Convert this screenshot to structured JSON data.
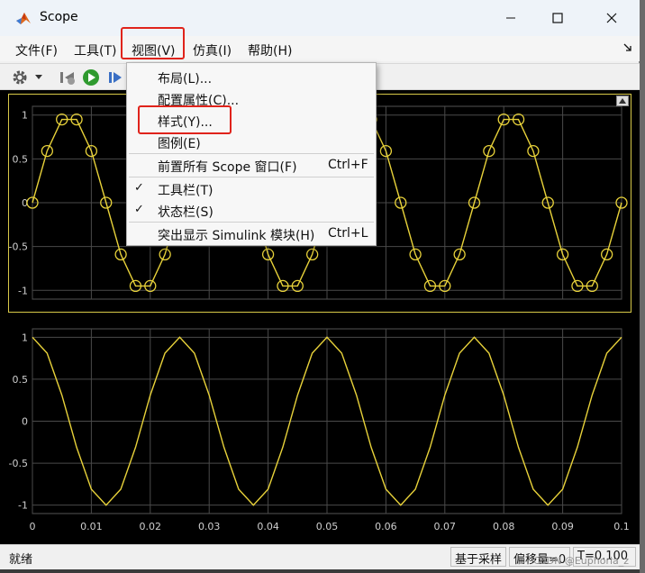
{
  "window": {
    "title": "Scope"
  },
  "menubar": {
    "items": [
      {
        "label": "文件(F)"
      },
      {
        "label": "工具(T)"
      },
      {
        "label": "视图(V)"
      },
      {
        "label": "仿真(I)"
      },
      {
        "label": "帮助(H)"
      }
    ]
  },
  "toolbar": {
    "icons": [
      "gear-icon",
      "dropdown-arrow-icon",
      "step-back-icon",
      "run-icon",
      "step-forward-icon"
    ]
  },
  "view_menu": {
    "items": [
      {
        "label": "布局(L)...",
        "accel": ""
      },
      {
        "label": "配置属性(C)...",
        "accel": ""
      },
      {
        "label": "样式(Y)...",
        "accel": ""
      },
      {
        "label": "图例(E)",
        "accel": ""
      },
      {
        "label": "前置所有 Scope 窗口(F)",
        "accel": "Ctrl+F"
      },
      {
        "label": "工具栏(T)",
        "accel": "",
        "checked": true
      },
      {
        "label": "状态栏(S)",
        "accel": "",
        "checked": true
      },
      {
        "label": "突出显示 Simulink 模块(H)",
        "accel": "Ctrl+L"
      }
    ]
  },
  "chart_data": [
    {
      "type": "line",
      "markers": "circle",
      "series": [
        {
          "color": "#e8d23a",
          "x": [
            0,
            0.0025,
            0.005,
            0.0075,
            0.01,
            0.0125,
            0.015,
            0.0175,
            0.02,
            0.0225,
            0.025,
            0.0275,
            0.03,
            0.0325,
            0.035,
            0.0375,
            0.04,
            0.0425,
            0.045,
            0.0475,
            0.05,
            0.0525,
            0.055,
            0.0575,
            0.06,
            0.0625,
            0.065,
            0.0675,
            0.07,
            0.0725,
            0.075,
            0.0775,
            0.08,
            0.0825,
            0.085,
            0.0875,
            0.09,
            0.0925,
            0.095,
            0.0975,
            0.1
          ],
          "y": [
            0,
            0.59,
            0.95,
            0.95,
            0.59,
            0,
            -0.59,
            -0.95,
            -0.95,
            -0.59,
            0,
            0.59,
            0.95,
            0.95,
            0.59,
            0,
            -0.59,
            -0.95,
            -0.95,
            -0.59,
            0,
            0.59,
            0.95,
            0.95,
            0.59,
            0,
            -0.59,
            -0.95,
            -0.95,
            -0.59,
            0,
            0.59,
            0.95,
            0.95,
            0.59,
            0,
            -0.59,
            -0.95,
            -0.95,
            -0.59,
            0
          ]
        }
      ],
      "ylim": [
        -1.1,
        1.1
      ],
      "xlim": [
        0,
        0.1
      ],
      "yticks": [
        "1",
        "0.5",
        "0",
        "-0.5",
        "-1"
      ],
      "grid": true
    },
    {
      "type": "line",
      "series": [
        {
          "color": "#e8d23a",
          "x": [
            0,
            0.0025,
            0.005,
            0.0075,
            0.01,
            0.0125,
            0.015,
            0.0175,
            0.02,
            0.0225,
            0.025,
            0.0275,
            0.03,
            0.0325,
            0.035,
            0.0375,
            0.04,
            0.0425,
            0.045,
            0.0475,
            0.05,
            0.0525,
            0.055,
            0.0575,
            0.06,
            0.0625,
            0.065,
            0.0675,
            0.07,
            0.0725,
            0.075,
            0.0775,
            0.08,
            0.0825,
            0.085,
            0.0875,
            0.09,
            0.0925,
            0.095,
            0.0975,
            0.1
          ],
          "y": [
            1,
            0.81,
            0.31,
            -0.31,
            -0.81,
            -1,
            -0.81,
            -0.31,
            0.31,
            0.81,
            1,
            0.81,
            0.31,
            -0.31,
            -0.81,
            -1,
            -0.81,
            -0.31,
            0.31,
            0.81,
            1,
            0.81,
            0.31,
            -0.31,
            -0.81,
            -1,
            -0.81,
            -0.31,
            0.31,
            0.81,
            1,
            0.81,
            0.31,
            -0.31,
            -0.81,
            -1,
            -0.81,
            -0.31,
            0.31,
            0.81,
            1
          ]
        }
      ],
      "ylim": [
        -1.1,
        1.1
      ],
      "xlim": [
        0,
        0.1
      ],
      "yticks": [
        "1",
        "0.5",
        "0",
        "-0.5",
        "-1"
      ],
      "xticks": [
        "0",
        "0.01",
        "0.02",
        "0.03",
        "0.04",
        "0.05",
        "0.06",
        "0.07",
        "0.08",
        "0.09",
        "0.1"
      ],
      "grid": true
    }
  ],
  "statusbar": {
    "left": "就绪",
    "mode": "基于采样",
    "offset": "偏移量=0",
    "time": "T=0.100"
  },
  "watermark": "CSDN @Euphoria_z",
  "colors": {
    "accent_red": "#e0231b",
    "trace": "#e8d23a",
    "grid": "#4a4a4a"
  }
}
